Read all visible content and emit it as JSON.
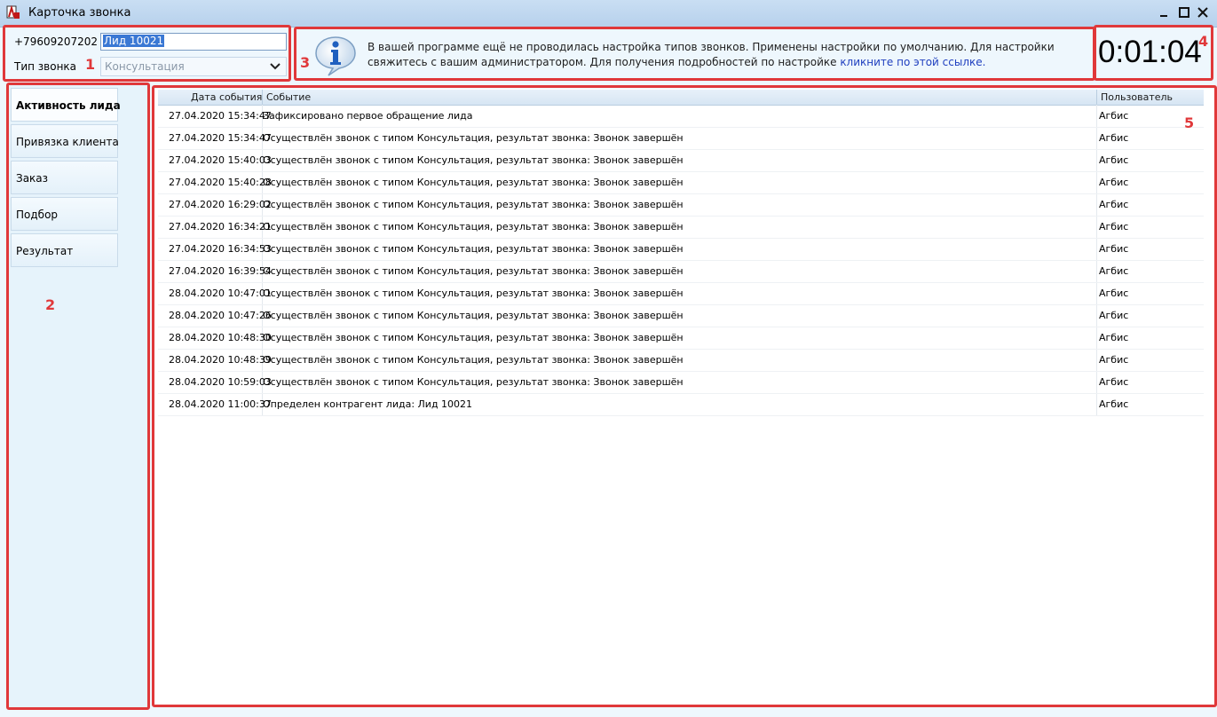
{
  "window": {
    "title": "Карточка звонка"
  },
  "header": {
    "phone": "+79609207202",
    "lead_value": "Лид 10021",
    "call_type_label": "Тип звонка",
    "call_type_value": "Консультация"
  },
  "info": {
    "text": "В вашей программе ещё не проводилась настройка типов звонков. Применены настройки по умолчанию. Для настройки свяжитесь с вашим администратором. Для получения подробностей по настройке ",
    "link": "кликните по этой ссылке."
  },
  "timer": "0:01:04",
  "badges": [
    "1",
    "2",
    "3",
    "4",
    "5"
  ],
  "nav": {
    "items": [
      {
        "label": "Активность лида"
      },
      {
        "label": "Привязка клиента"
      },
      {
        "label": "Заказ"
      },
      {
        "label": "Подбор"
      },
      {
        "label": "Результат"
      }
    ]
  },
  "table": {
    "columns": [
      "Дата события",
      "Событие",
      "Пользователь"
    ],
    "rows": [
      {
        "date": "27.04.2020 15:34:47",
        "event": "Зафиксировано первое обращение лида",
        "user": "Агбис"
      },
      {
        "date": "27.04.2020 15:34:47",
        "event": "Осуществлён звонок с типом Консультация, результат звонка: Звонок завершён",
        "user": "Агбис"
      },
      {
        "date": "27.04.2020 15:40:03",
        "event": "Осуществлён звонок с типом Консультация, результат звонка: Звонок завершён",
        "user": "Агбис"
      },
      {
        "date": "27.04.2020 15:40:28",
        "event": "Осуществлён звонок с типом Консультация, результат звонка: Звонок завершён",
        "user": "Агбис"
      },
      {
        "date": "27.04.2020 16:29:02",
        "event": "Осуществлён звонок с типом Консультация, результат звонка: Звонок завершён",
        "user": "Агбис"
      },
      {
        "date": "27.04.2020 16:34:21",
        "event": "Осуществлён звонок с типом Консультация, результат звонка: Звонок завершён",
        "user": "Агбис"
      },
      {
        "date": "27.04.2020 16:34:53",
        "event": "Осуществлён звонок с типом Консультация, результат звонка: Звонок завершён",
        "user": "Агбис"
      },
      {
        "date": "27.04.2020 16:39:54",
        "event": "Осуществлён звонок с типом Консультация, результат звонка: Звонок завершён",
        "user": "Агбис"
      },
      {
        "date": "28.04.2020 10:47:01",
        "event": "Осуществлён звонок с типом Консультация, результат звонка: Звонок завершён",
        "user": "Агбис"
      },
      {
        "date": "28.04.2020 10:47:26",
        "event": "Осуществлён звонок с типом Консультация, результат звонка: Звонок завершён",
        "user": "Агбис"
      },
      {
        "date": "28.04.2020 10:48:30",
        "event": "Осуществлён звонок с типом Консультация, результат звонка: Звонок завершён",
        "user": "Агбис"
      },
      {
        "date": "28.04.2020 10:48:39",
        "event": "Осуществлён звонок с типом Консультация, результат звонка: Звонок завершён",
        "user": "Агбис"
      },
      {
        "date": "28.04.2020 10:59:03",
        "event": "Осуществлён звонок с типом Консультация, результат звонка: Звонок завершён",
        "user": "Агбис"
      },
      {
        "date": "28.04.2020 11:00:37",
        "event": "Определен контрагент лида: Лид 10021",
        "user": "Агбис"
      }
    ]
  },
  "colors": {
    "annotation": "#e0383a",
    "link": "#1f3fbf"
  },
  "icons": [
    "app-icon",
    "minimize-icon",
    "maximize-icon",
    "close-icon",
    "chevron-down-icon",
    "info-icon"
  ]
}
